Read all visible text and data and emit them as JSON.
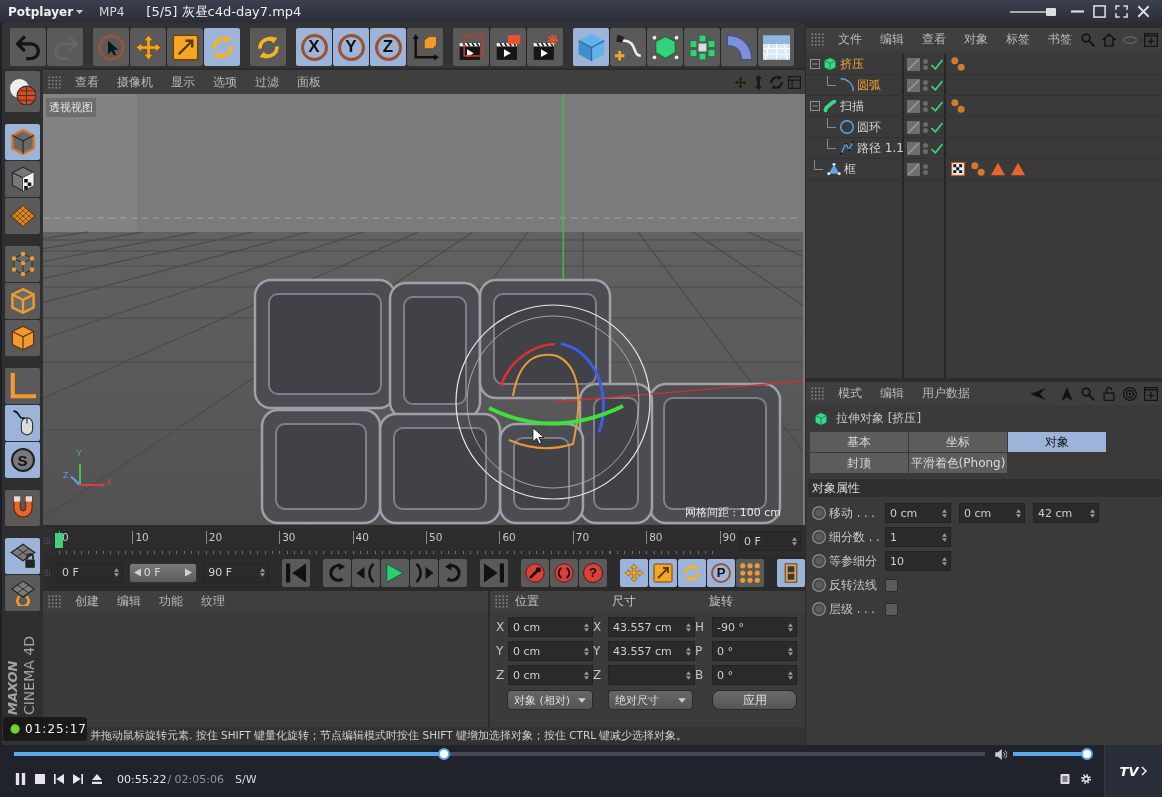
{
  "player": {
    "app_menu": "Potplayer",
    "format": "MP4",
    "file_title": "[5/5] 灰昼c4d-day7.mp4",
    "title_slider": {
      "level": 1
    },
    "recording_timer": "01:25:17",
    "seek": {
      "level": 0.443
    },
    "volume": {
      "level": 1
    },
    "current_time": "00:55:22",
    "total_time": "/ 02:05:06",
    "mode": "S/W",
    "tv_label": "TV"
  },
  "toolbar": [
    [
      {
        "kind": "undo",
        "selected": false,
        "disabled": false
      },
      {
        "kind": "redo",
        "selected": false,
        "disabled": true
      }
    ],
    [
      {
        "kind": "select",
        "selected": false,
        "disabled": false
      },
      {
        "kind": "move",
        "selected": false,
        "disabled": false
      },
      {
        "kind": "scale",
        "selected": false,
        "disabled": false
      },
      {
        "kind": "rotate",
        "selected": true,
        "disabled": false
      }
    ],
    [
      {
        "kind": "rotate",
        "selected": false,
        "disabled": false
      }
    ],
    [
      {
        "kind": "axis",
        "label": "X",
        "selected": true,
        "disabled": false
      },
      {
        "kind": "axis",
        "label": "Y",
        "selected": true,
        "disabled": false
      },
      {
        "kind": "axis",
        "label": "Z",
        "selected": true,
        "disabled": false
      },
      {
        "kind": "coord",
        "selected": false,
        "disabled": false
      }
    ],
    [
      {
        "kind": "render_view",
        "selected": false,
        "disabled": false
      },
      {
        "kind": "render_picture",
        "selected": false,
        "disabled": false
      },
      {
        "kind": "render_settings",
        "selected": false,
        "disabled": false
      }
    ],
    [
      {
        "kind": "cube",
        "selected": true,
        "disabled": false
      },
      {
        "kind": "spline",
        "selected": false,
        "disabled": false
      },
      {
        "kind": "nurbs",
        "selected": false,
        "disabled": false
      },
      {
        "kind": "array",
        "selected": false,
        "disabled": false
      },
      {
        "kind": "deformer",
        "selected": false,
        "disabled": false
      },
      {
        "kind": "floor",
        "selected": false,
        "disabled": false
      }
    ]
  ],
  "side_toolbar": [
    [
      {
        "kind": "bodypaint",
        "selected": false
      }
    ],
    [
      {
        "kind": "model",
        "selected": true
      },
      {
        "kind": "texture",
        "selected": false
      },
      {
        "kind": "workplane",
        "selected": false
      }
    ],
    [
      {
        "kind": "points",
        "selected": false
      },
      {
        "kind": "edges",
        "selected": false
      },
      {
        "kind": "polygons",
        "selected": false
      }
    ],
    [
      {
        "kind": "axis_mode",
        "selected": false
      },
      {
        "kind": "tweak",
        "selected": true
      },
      {
        "kind": "snap",
        "label": "S",
        "selected": true
      }
    ],
    [
      {
        "kind": "magnet",
        "selected": false
      }
    ],
    [
      {
        "kind": "grid_lock",
        "selected": true
      },
      {
        "kind": "grid_rotate",
        "selected": false
      }
    ]
  ],
  "logo": {
    "brand": "MAXON",
    "product": "CINEMA 4D"
  },
  "viewport": {
    "menu": [
      "查看",
      "摄像机",
      "显示",
      "选项",
      "过滤",
      "面板"
    ],
    "view_label": "透视视图",
    "grid_spacing": "网格间距 : 100 cm",
    "axes": [
      {
        "label": "Y",
        "color": "#44c04c"
      },
      {
        "label": "Z",
        "color": "#6f8fe0"
      },
      {
        "label": "X",
        "color": "#d84040"
      }
    ]
  },
  "timeline": {
    "ticks": [
      "0",
      "10",
      "20",
      "30",
      "40",
      "50",
      "60",
      "70",
      "80",
      "90"
    ],
    "playhead": {
      "level": 0
    },
    "current_frame": "0 F"
  },
  "transport": {
    "start_frame": "0 F",
    "preview_frame": "0 F",
    "end_frame": "90 F",
    "groups": [
      [
        {
          "kind": "goto_start",
          "selected": false
        }
      ],
      [
        {
          "kind": "prev_key",
          "selected": false
        },
        {
          "kind": "prev_frame",
          "selected": false
        },
        {
          "kind": "play",
          "selected": false
        },
        {
          "kind": "next_frame",
          "selected": false
        },
        {
          "kind": "next_key",
          "selected": false
        }
      ],
      [
        {
          "kind": "goto_end",
          "selected": false
        }
      ],
      [
        {
          "kind": "record",
          "selected": false
        },
        {
          "kind": "autokey",
          "selected": false
        },
        {
          "kind": "help",
          "label": "?",
          "selected": false
        }
      ],
      [
        {
          "kind": "key_move",
          "selected": true
        },
        {
          "kind": "key_scale",
          "selected": true
        },
        {
          "kind": "key_rotate",
          "selected": true
        },
        {
          "kind": "param",
          "label": "P",
          "selected": true
        },
        {
          "kind": "dots",
          "selected": false
        }
      ],
      [
        {
          "kind": "film",
          "selected": true
        }
      ]
    ]
  },
  "material_manager": {
    "menu": [
      "创建",
      "编辑",
      "功能",
      "纹理"
    ]
  },
  "coordinates": {
    "headers": [
      "位置",
      "尺寸",
      "旋转"
    ],
    "rows": [
      {
        "axis": "X",
        "position": "0 cm",
        "size_axis": "X",
        "size": "43.557 cm",
        "rotation_axis": "H",
        "rotation": "-90 °"
      },
      {
        "axis": "Y",
        "position": "0 cm",
        "size_axis": "Y",
        "size": "43.557 cm",
        "rotation_axis": "P",
        "rotation": "0 °"
      },
      {
        "axis": "Z",
        "position": "0 cm",
        "size_axis": "Z",
        "rotation_axis": "B",
        "rotation": "0 °"
      }
    ],
    "dropdowns": [
      "对象 (相对)",
      "绝对尺寸"
    ],
    "apply": "应用"
  },
  "status": "并拖动鼠标旋转元素. 按住 SHIFT 键量化旋转；节点编辑模式时按住 SHIFT 键增加选择对象；按住 CTRL 键减少选择对象。",
  "object_manager": {
    "menu": [
      "文件",
      "编辑",
      "查看",
      "对象",
      "标签",
      "书签"
    ],
    "objects": [
      {
        "name": "挤压",
        "kind": "extrude",
        "selected": true,
        "expanded": true,
        "enabled": true,
        "tags": [
          {
            "kind": "phong"
          }
        ],
        "children": [
          {
            "name": "圆弧",
            "kind": "arc",
            "selected": true,
            "enabled": true
          }
        ]
      },
      {
        "name": "扫描",
        "kind": "sweep",
        "selected": false,
        "expanded": true,
        "enabled": true,
        "tags": [
          {
            "kind": "phong"
          }
        ],
        "children": [
          {
            "name": "圆环",
            "kind": "circle",
            "selected": false,
            "enabled": true
          },
          {
            "name": "路径 1.1",
            "kind": "path",
            "selected": false,
            "enabled": true
          }
        ]
      },
      {
        "name": "框",
        "kind": "frame",
        "selected": false,
        "enabled": false,
        "tags": [
          {
            "kind": "texture"
          },
          {
            "kind": "phong"
          },
          {
            "kind": "triangle"
          },
          {
            "kind": "triangle"
          }
        ]
      }
    ]
  },
  "attributes": {
    "menu": [
      "模式",
      "编辑",
      "用户数据"
    ],
    "title": "拉伸对象 [挤压]",
    "tabs": [
      {
        "label": "基本",
        "selected": false
      },
      {
        "label": "坐标",
        "selected": false
      },
      {
        "label": "对象",
        "selected": true
      },
      {
        "label": "封顶",
        "selected": false
      },
      {
        "label": "平滑着色(Phong)",
        "selected": false
      }
    ],
    "section": "对象属性",
    "params": [
      {
        "kind": "fields",
        "label": "移动 . . .",
        "values": [
          "0 cm",
          "0 cm",
          "42 cm"
        ]
      },
      {
        "kind": "fields",
        "label": "细分数 . .",
        "values": [
          "1"
        ]
      },
      {
        "kind": "fields",
        "label": "等参细分",
        "values": [
          "10"
        ]
      },
      {
        "kind": "checkbox",
        "label": "反转法线",
        "checked": false
      },
      {
        "kind": "checkbox",
        "label": "层级 . . .",
        "checked": false
      }
    ]
  }
}
